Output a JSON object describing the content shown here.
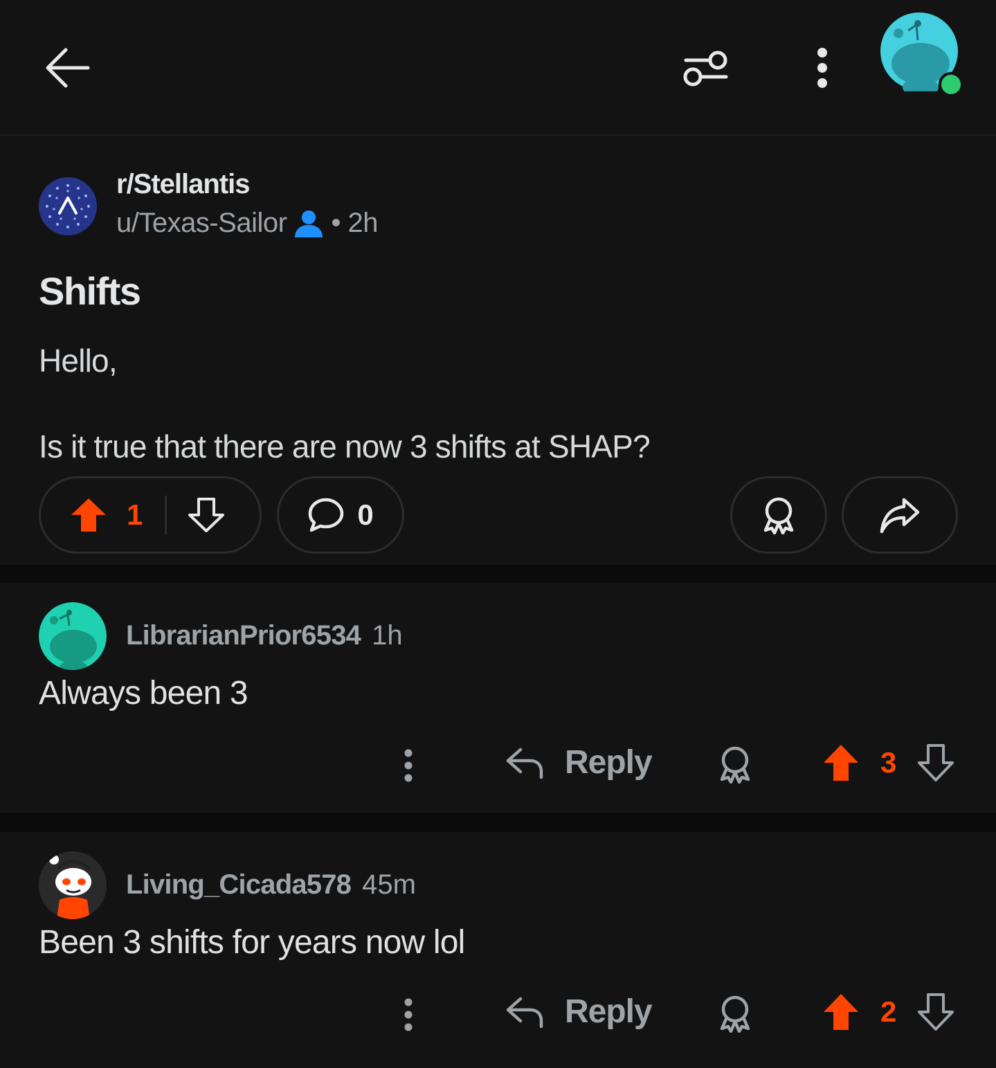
{
  "header": {
    "back_icon": "back-arrow-icon",
    "filter_icon": "sort-filter-icon",
    "more_icon": "more-vertical-icon",
    "avatar_icon": "user-avatar-snoo",
    "online_color": "#2ecc71"
  },
  "post": {
    "subreddit": "r/Stellantis",
    "author": "u/Texas-Sailor",
    "time": "• 2h",
    "title": "Shifts",
    "body_line1": "Hello,",
    "body_line2": "Is it true that there are now 3 shifts at SHAP?",
    "upvotes": "1",
    "comments": "0",
    "accent_color": "#ff4500"
  },
  "comments": [
    {
      "user": "LibrarianPrior6534",
      "time": "1h",
      "body": "Always been 3",
      "reply_label": "Reply",
      "votes": "3"
    },
    {
      "user": "Living_Cicada578",
      "time": "45m",
      "body": "Been 3 shifts for years now lol",
      "reply_label": "Reply",
      "votes": "2"
    }
  ]
}
